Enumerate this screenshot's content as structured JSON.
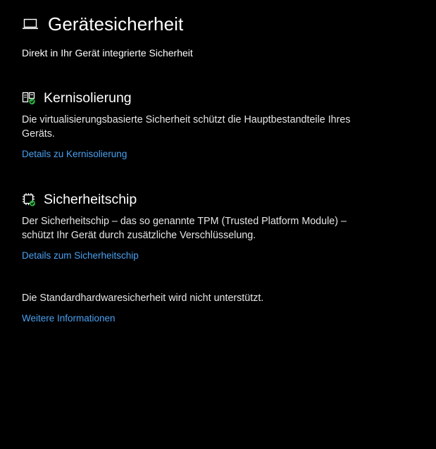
{
  "header": {
    "icon": "laptop-icon",
    "title": "Gerätesicherheit",
    "subtitle": "Direkt in Ihr Gerät integrierte Sicherheit"
  },
  "sections": [
    {
      "icon": "core-isolation-icon",
      "title": "Kernisolierung",
      "description": "Die virtualisierungsbasierte Sicherheit schützt die Hauptbestandteile Ihres Geräts.",
      "link": "Details zu Kernisolierung"
    },
    {
      "icon": "security-chip-icon",
      "title": "Sicherheitschip",
      "description": "Der Sicherheitschip – das so genannte TPM (Trusted Platform Module) – schützt Ihr Gerät durch zusätzliche Verschlüsselung.",
      "link": "Details zum Sicherheitschip"
    }
  ],
  "hardware_status": {
    "text": "Die Standardhardwaresicherheit wird nicht unterstützt.",
    "link": "Weitere Informationen"
  },
  "colors": {
    "background": "#000000",
    "text": "#ffffff",
    "link": "#4aa0f0",
    "status_ok": "#2fb344"
  }
}
